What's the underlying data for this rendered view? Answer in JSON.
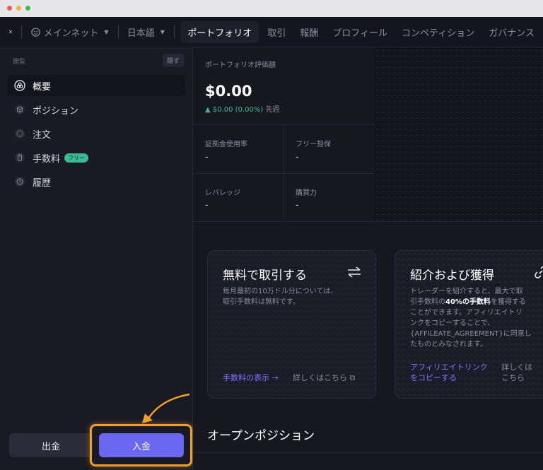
{
  "topbar": {
    "network": "メインネット",
    "language": "日本語",
    "tabs": [
      "ポートフォリオ",
      "取引",
      "報酬",
      "プロフィール",
      "コンペティション",
      "ガバナンス"
    ]
  },
  "sidebar": {
    "section_label": "閲覧",
    "hide_label": "隠す",
    "items": [
      {
        "label": "概要",
        "icon": "overview-icon"
      },
      {
        "label": "ポジション",
        "icon": "cube-icon"
      },
      {
        "label": "注文",
        "icon": "orders-icon"
      },
      {
        "label": "手数料",
        "icon": "calculator-icon",
        "badge": "フリー"
      },
      {
        "label": "履歴",
        "icon": "clock-icon"
      }
    ],
    "withdraw_label": "出金",
    "deposit_label": "入金"
  },
  "portfolio": {
    "value_label": "ポートフォリオ評価額",
    "value": "$0.00",
    "change": "▲ $0.00 (0.00%)",
    "change_period": "先週",
    "margin_label": "証拠金使用率",
    "margin_value": "-",
    "free_collateral_label": "フリー担保",
    "free_collateral_value": "-",
    "leverage_label": "レバレッジ",
    "leverage_value": "-",
    "buying_power_label": "購買力",
    "buying_power_value": "-"
  },
  "cards": {
    "free_trading": {
      "title": "無料で取引する",
      "body_line1": "毎月最初の10万ドル分については、",
      "body_line2": "取引手数料は無料です。",
      "link_fees": "手数料の表示 →",
      "link_learn": "詳しくはこちら ⧉"
    },
    "referral": {
      "title": "紹介および獲得",
      "body_line1": "トレーダーを紹介すると、最大で取",
      "body_line2_pre": "引手数料の",
      "body_line2_bold": "40%の手数料",
      "body_line2_post": "を獲得する",
      "body_line3": "ことができます。アフィリエイトリ",
      "body_line4": "ンクをコピーすることで、",
      "body_line5": "{AFFILEATE_AGREEMENT}に同意し",
      "body_line6": "たものとみなされます。",
      "link_copy_line1": "アフィリエイトリンク",
      "link_copy_line2": "をコピーする",
      "link_learn_line1": "詳しくは",
      "link_learn_line2": "こちら"
    }
  },
  "positions": {
    "title": "オープンポジション"
  },
  "colors": {
    "accent": "#6c67f2",
    "positive": "#3dba94",
    "highlight": "#f0a02a"
  }
}
